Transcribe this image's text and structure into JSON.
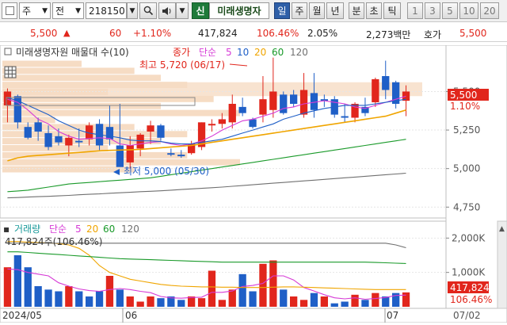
{
  "toolbar": {
    "type_label": "주",
    "type_sep": "전",
    "code": "218150",
    "company_badge": "신",
    "company_name": "미래생명자",
    "period_day": "일",
    "period_week": "주",
    "period_month": "월",
    "period_year": "년",
    "period_minute": "분",
    "period_tick_seconds": "초",
    "period_tick": "틱",
    "counts": [
      "1",
      "3",
      "5",
      "10",
      "20"
    ]
  },
  "status": {
    "price": "5,500",
    "change": "60",
    "change_pct": "+1.10%",
    "volume": "417,824",
    "volume_ratio": "106.46%",
    "turnover": "2.05%",
    "amount": "2,273백만",
    "quote_label": "호가",
    "quote_price": "5,500"
  },
  "colors": {
    "up": "#e1261c",
    "down": "#1f5fc7",
    "ma5": "#d63bd6",
    "ma10": "#1f5fc7",
    "ma20": "#f0a500",
    "ma60": "#1a9a2a",
    "ma120": "#707070",
    "overlap_band": "#f6dcc4"
  },
  "price_panel": {
    "legend_title": "미래생명자원 매물대 수(10)",
    "legend_close": "종가",
    "legend_ma_label": "단순",
    "ma_periods": [
      "5",
      "10",
      "20",
      "60",
      "120"
    ],
    "high_annotation": "최고 5,720 (06/17)",
    "low_annotation": "최저 5,000 (05/30)",
    "current_price_tag": "5,500",
    "current_change_tag": "1.10%"
  },
  "volume_panel": {
    "legend_title": "거래량",
    "legend_ma_label": "단순",
    "ma_periods": [
      "5",
      "20",
      "60",
      "120"
    ],
    "current_volume_text": "417,824주(106.46%)",
    "current_volume_tag": "417,824",
    "current_ratio_tag": "106.46%"
  },
  "x_axis": {
    "labels": [
      "2024/05",
      "06",
      "07",
      "07/02"
    ]
  },
  "chart_data": [
    {
      "type": "candlestick",
      "title": "미래생명자원 매물대 수(10)",
      "y_ticks": [
        "5,500",
        "5,250",
        "5,000",
        "4,750"
      ],
      "ylim": [
        4700,
        5780
      ],
      "grid": true,
      "candles": [
        {
          "o": 5410,
          "h": 5520,
          "l": 5300,
          "c": 5500
        },
        {
          "o": 5470,
          "h": 5480,
          "l": 5260,
          "c": 5300
        },
        {
          "o": 5270,
          "h": 5300,
          "l": 5190,
          "c": 5200
        },
        {
          "o": 5300,
          "h": 5330,
          "l": 5180,
          "c": 5240
        },
        {
          "o": 5230,
          "h": 5280,
          "l": 5120,
          "c": 5140
        },
        {
          "o": 5210,
          "h": 5260,
          "l": 5150,
          "c": 5170
        },
        {
          "o": 5150,
          "h": 5220,
          "l": 5080,
          "c": 5200
        },
        {
          "o": 5180,
          "h": 5260,
          "l": 5140,
          "c": 5170
        },
        {
          "o": 5190,
          "h": 5300,
          "l": 5150,
          "c": 5280
        },
        {
          "o": 5290,
          "h": 5320,
          "l": 5120,
          "c": 5150
        },
        {
          "o": 5270,
          "h": 5410,
          "l": 5150,
          "c": 5190
        },
        {
          "o": 5150,
          "h": 5420,
          "l": 5030,
          "c": 5010
        },
        {
          "o": 5040,
          "h": 5210,
          "l": 5000,
          "c": 5150
        },
        {
          "o": 5130,
          "h": 5230,
          "l": 5080,
          "c": 5220
        },
        {
          "o": 5240,
          "h": 5310,
          "l": 5160,
          "c": 5280
        },
        {
          "o": 5280,
          "h": 5290,
          "l": 5180,
          "c": 5200
        },
        {
          "o": 5100,
          "h": 5130,
          "l": 5080,
          "c": 5090
        },
        {
          "o": 5090,
          "h": 5120,
          "l": 5070,
          "c": 5080
        },
        {
          "o": 5100,
          "h": 5180,
          "l": 5090,
          "c": 5160
        },
        {
          "o": 5140,
          "h": 5300,
          "l": 5120,
          "c": 5300
        },
        {
          "o": 5280,
          "h": 5320,
          "l": 5240,
          "c": 5290
        },
        {
          "o": 5290,
          "h": 5360,
          "l": 5260,
          "c": 5320
        },
        {
          "o": 5300,
          "h": 5480,
          "l": 5260,
          "c": 5420
        },
        {
          "o": 5400,
          "h": 5460,
          "l": 5340,
          "c": 5360
        },
        {
          "o": 5320,
          "h": 5330,
          "l": 5260,
          "c": 5270
        },
        {
          "o": 5350,
          "h": 5600,
          "l": 5300,
          "c": 5450
        },
        {
          "o": 5380,
          "h": 5720,
          "l": 5330,
          "c": 5500
        },
        {
          "o": 5480,
          "h": 5500,
          "l": 5350,
          "c": 5360
        },
        {
          "o": 5480,
          "h": 5510,
          "l": 5400,
          "c": 5420
        },
        {
          "o": 5350,
          "h": 5620,
          "l": 5330,
          "c": 5510
        },
        {
          "o": 5490,
          "h": 5620,
          "l": 5330,
          "c": 5380
        },
        {
          "o": 5450,
          "h": 5480,
          "l": 5400,
          "c": 5440
        },
        {
          "o": 5450,
          "h": 5470,
          "l": 5330,
          "c": 5350
        },
        {
          "o": 5340,
          "h": 5420,
          "l": 5300,
          "c": 5330
        },
        {
          "o": 5330,
          "h": 5430,
          "l": 5300,
          "c": 5420
        },
        {
          "o": 5400,
          "h": 5460,
          "l": 5340,
          "c": 5360
        },
        {
          "o": 5430,
          "h": 5590,
          "l": 5400,
          "c": 5580
        },
        {
          "o": 5600,
          "h": 5700,
          "l": 5450,
          "c": 5510
        },
        {
          "o": 5560,
          "h": 5570,
          "l": 5390,
          "c": 5420
        },
        {
          "o": 5440,
          "h": 5540,
          "l": 5340,
          "c": 5500
        }
      ],
      "ma_series": [
        {
          "name": "5",
          "values": [
            5450,
            5430,
            5380,
            5320,
            5290,
            5240,
            5210,
            5190,
            5195,
            5200,
            5195,
            5160,
            5150,
            5160,
            5170,
            5175,
            5160,
            5150,
            5160,
            5180,
            5210,
            5250,
            5280,
            5310,
            5320,
            5340,
            5360,
            5390,
            5400,
            5420,
            5430,
            5440,
            5430,
            5420,
            5400,
            5390,
            5410,
            5430,
            5450,
            5470
          ]
        },
        {
          "name": "10",
          "values": [
            5460,
            5440,
            5410,
            5380,
            5350,
            5310,
            5280,
            5250,
            5230,
            5220,
            5210,
            5200,
            5185,
            5180,
            5180,
            5175,
            5165,
            5160,
            5160,
            5170,
            5180,
            5190,
            5210,
            5230,
            5250,
            5270,
            5290,
            5320,
            5340,
            5360,
            5375,
            5390,
            5400,
            5410,
            5410,
            5410,
            5420,
            5430,
            5440,
            5450
          ]
        },
        {
          "name": "20",
          "values": [
            5050,
            5070,
            5080,
            5085,
            5090,
            5095,
            5100,
            5105,
            5110,
            5115,
            5118,
            5120,
            5122,
            5125,
            5130,
            5135,
            5140,
            5145,
            5150,
            5160,
            5170,
            5180,
            5190,
            5200,
            5210,
            5220,
            5230,
            5240,
            5250,
            5260,
            5270,
            5280,
            5290,
            5300,
            5310,
            5320,
            5330,
            5340,
            5360,
            5380
          ]
        },
        {
          "name": "60",
          "values": [
            4850,
            4855,
            4860,
            4870,
            4880,
            4890,
            4900,
            4905,
            4910,
            4915,
            4920,
            4925,
            4930,
            4935,
            4940,
            4950,
            4960,
            4970,
            4980,
            4990,
            5000,
            5010,
            5020,
            5030,
            5040,
            5050,
            5060,
            5070,
            5080,
            5090,
            5100,
            5110,
            5120,
            5130,
            5140,
            5150,
            5160,
            5170,
            5180,
            5190
          ]
        },
        {
          "name": "120",
          "values": [
            4810,
            4812,
            4815,
            4818,
            4820,
            4823,
            4826,
            4830,
            4833,
            4836,
            4840,
            4843,
            4846,
            4850,
            4853,
            4856,
            4860,
            4864,
            4868,
            4872,
            4876,
            4880,
            4885,
            4890,
            4895,
            4900,
            4905,
            4910,
            4915,
            4920,
            4925,
            4930,
            4935,
            4940,
            4945,
            4950,
            4955,
            4960,
            4965,
            4970
          ]
        }
      ]
    },
    {
      "type": "bar",
      "title": "거래량",
      "y_ticks": [
        "2,000K",
        "1,000K"
      ],
      "ylim": [
        0,
        2400
      ],
      "grid": true,
      "values_k": [
        1150,
        1500,
        1150,
        600,
        500,
        450,
        600,
        450,
        300,
        450,
        900,
        500,
        300,
        150,
        300,
        250,
        300,
        200,
        300,
        250,
        1050,
        200,
        500,
        950,
        450,
        1250,
        1350,
        500,
        300,
        200,
        400,
        300,
        100,
        150,
        350,
        200,
        400,
        300,
        400,
        418
      ],
      "up": [
        true,
        false,
        false,
        false,
        false,
        false,
        true,
        false,
        false,
        false,
        true,
        false,
        true,
        true,
        true,
        false,
        false,
        false,
        true,
        true,
        true,
        true,
        true,
        false,
        false,
        true,
        true,
        false,
        true,
        true,
        false,
        true,
        false,
        false,
        true,
        false,
        true,
        false,
        false,
        true
      ],
      "ma_series": [
        {
          "name": "5",
          "values": [
            1100,
            1080,
            1000,
            950,
            900,
            700,
            600,
            520,
            470,
            450,
            500,
            530,
            500,
            450,
            410,
            300,
            260,
            250,
            270,
            280,
            420,
            420,
            460,
            590,
            620,
            680,
            900,
            900,
            780,
            560,
            460,
            350,
            260,
            230,
            260,
            220,
            240,
            270,
            330,
            340
          ]
        },
        {
          "name": "20",
          "values": [
            1900,
            1900,
            1880,
            1870,
            1860,
            1840,
            1800,
            1700,
            1500,
            1200,
            1000,
            900,
            800,
            750,
            700,
            650,
            620,
            600,
            590,
            580,
            580,
            570,
            570,
            560,
            560,
            560,
            570,
            580,
            580,
            570,
            560,
            550,
            540,
            530,
            520,
            510,
            500,
            500,
            500,
            500
          ]
        },
        {
          "name": "60",
          "values": [
            1600,
            1600,
            1580,
            1560,
            1540,
            1520,
            1500,
            1480,
            1460,
            1440,
            1420,
            1400,
            1390,
            1380,
            1370,
            1360,
            1350,
            1340,
            1330,
            1320,
            1310,
            1300,
            1300,
            1300,
            1300,
            1300,
            1300,
            1300,
            1300,
            1300,
            1300,
            1300,
            1300,
            1300,
            1300,
            1300,
            1290,
            1280,
            1270,
            1260
          ]
        },
        {
          "name": "120",
          "values": [
            1850,
            1850,
            1850,
            1850,
            1850,
            1850,
            1850,
            1850,
            1850,
            1850,
            1850,
            1850,
            1850,
            1850,
            1850,
            1850,
            1850,
            1850,
            1850,
            1850,
            1850,
            1850,
            1850,
            1850,
            1850,
            1850,
            1850,
            1850,
            1850,
            1850,
            1850,
            1850,
            1850,
            1850,
            1850,
            1850,
            1850,
            1850,
            1800,
            1720
          ]
        }
      ]
    }
  ],
  "overlap_bands_pct": [
    6,
    10,
    12,
    14,
    8,
    16,
    12,
    18,
    4,
    10,
    14,
    12,
    8,
    14,
    18,
    10
  ]
}
